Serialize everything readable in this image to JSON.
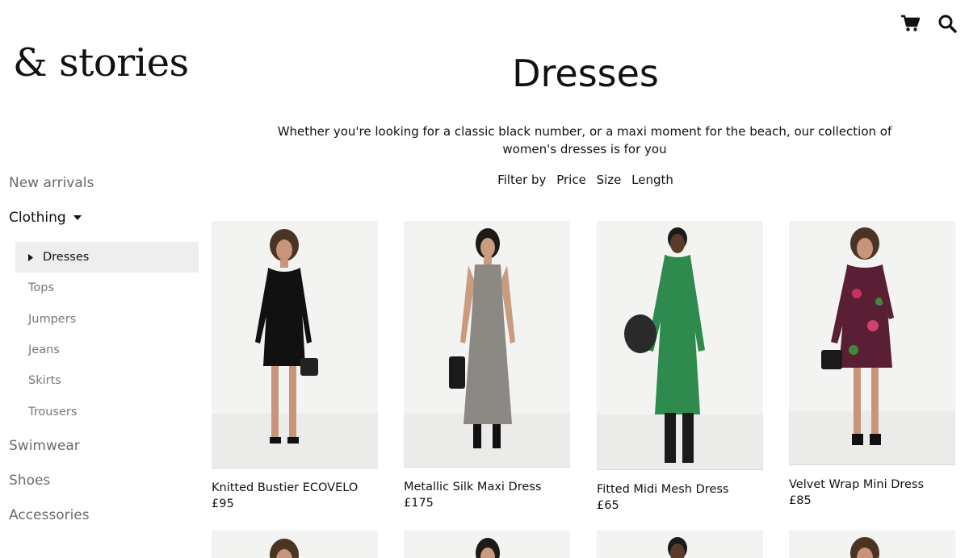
{
  "brand": {
    "logo": "& stories"
  },
  "header": {
    "icons": [
      "cart-icon",
      "search-icon"
    ]
  },
  "sidebar": {
    "top_items": [
      {
        "label": "New arrivals"
      },
      {
        "label": "Clothing",
        "expanded": true
      },
      {
        "label": "Swimwear"
      },
      {
        "label": "Shoes"
      },
      {
        "label": "Accessories"
      }
    ],
    "clothing_items": [
      {
        "label": "Dresses",
        "selected": true
      },
      {
        "label": "Tops"
      },
      {
        "label": "Jumpers"
      },
      {
        "label": "Jeans"
      },
      {
        "label": "Skirts"
      },
      {
        "label": "Trousers"
      }
    ]
  },
  "main": {
    "title": "Dresses",
    "intro": "Whether you're looking for a classic black number, or a maxi moment for the beach, our collection of women's dresses is for you",
    "filters": {
      "label": "Filter by",
      "options": [
        "Price",
        "Size",
        "Length"
      ]
    }
  },
  "products": [
    {
      "name": "Knitted Bustier ECOVELO",
      "price": "£95",
      "dress_color": "#111111"
    },
    {
      "name": "Metallic Silk Maxi Dress",
      "price": "£175",
      "dress_color": "#8c8884"
    },
    {
      "name": "Fitted Midi Mesh Dress",
      "price": "£65",
      "dress_color": "#2f8a4e"
    },
    {
      "name": "Velvet Wrap Mini Dress",
      "price": "£85",
      "dress_color": "#5a1f35"
    }
  ]
}
